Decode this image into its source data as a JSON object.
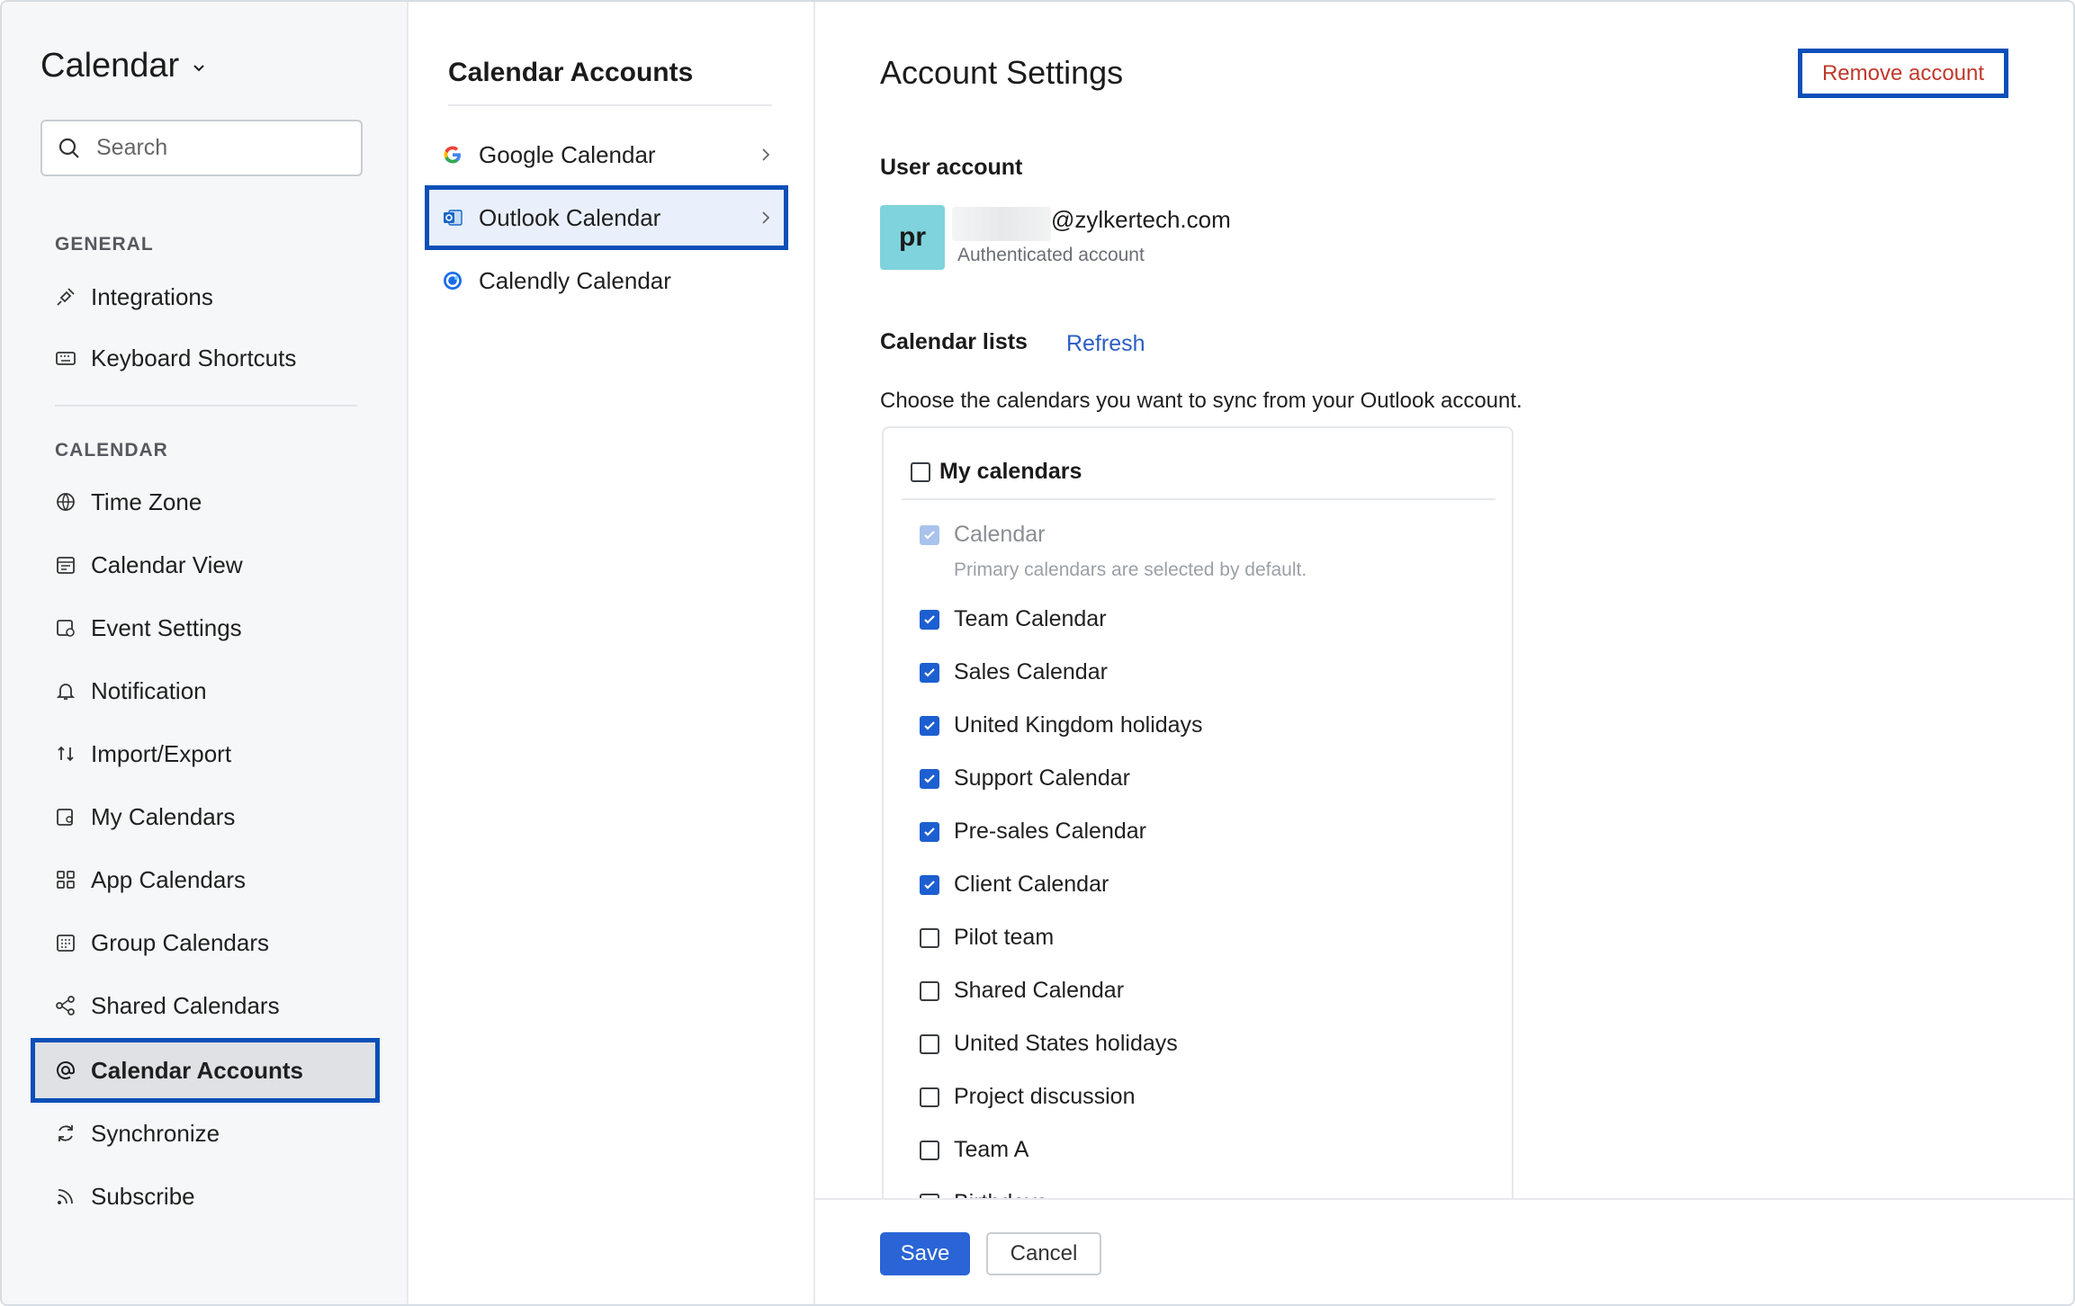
{
  "sidebar": {
    "app_title": "Calendar",
    "search_placeholder": "Search",
    "general_heading": "GENERAL",
    "general_items": [
      {
        "label": "Integrations",
        "icon": "plug-icon"
      },
      {
        "label": "Keyboard Shortcuts",
        "icon": "keyboard-icon"
      }
    ],
    "calendar_heading": "CALENDAR",
    "calendar_items": [
      {
        "label": "Time Zone",
        "icon": "globe-icon"
      },
      {
        "label": "Calendar View",
        "icon": "calendar-view-icon"
      },
      {
        "label": "Event Settings",
        "icon": "event-settings-icon"
      },
      {
        "label": "Notification",
        "icon": "bell-icon"
      },
      {
        "label": "Import/Export",
        "icon": "import-export-icon"
      },
      {
        "label": "My Calendars",
        "icon": "my-calendars-icon"
      },
      {
        "label": "App Calendars",
        "icon": "apps-grid-icon"
      },
      {
        "label": "Group Calendars",
        "icon": "group-calendar-icon"
      },
      {
        "label": "Shared Calendars",
        "icon": "share-icon"
      },
      {
        "label": "Calendar Accounts",
        "icon": "at-sign-icon",
        "active": true
      },
      {
        "label": "Synchronize",
        "icon": "sync-icon"
      },
      {
        "label": "Subscribe",
        "icon": "rss-icon"
      }
    ]
  },
  "accounts": {
    "title": "Calendar Accounts",
    "items": [
      {
        "label": "Google Calendar",
        "icon": "google-icon"
      },
      {
        "label": "Outlook Calendar",
        "icon": "outlook-icon",
        "active": true
      },
      {
        "label": "Calendly Calendar",
        "icon": "calendly-icon"
      }
    ]
  },
  "settings": {
    "title": "Account Settings",
    "remove_label": "Remove account",
    "user_account_label": "User account",
    "avatar_initials": "pr",
    "email_domain": "@zylkertech.com",
    "auth_note": "Authenticated account",
    "lists_label": "Calendar lists",
    "refresh_label": "Refresh",
    "lists_description": "Choose the calendars you want to sync from your Outlook account.",
    "group_label": "My calendars",
    "primary_calendar": "Calendar",
    "primary_note": "Primary calendars are selected by default.",
    "calendars": [
      {
        "label": "Team Calendar",
        "checked": true
      },
      {
        "label": "Sales Calendar",
        "checked": true
      },
      {
        "label": "United Kingdom holidays",
        "checked": true
      },
      {
        "label": "Support Calendar",
        "checked": true
      },
      {
        "label": "Pre-sales Calendar",
        "checked": true
      },
      {
        "label": "Client Calendar",
        "checked": true
      },
      {
        "label": "Pilot team",
        "checked": false
      },
      {
        "label": "Shared Calendar",
        "checked": false
      },
      {
        "label": "United States holidays",
        "checked": false
      },
      {
        "label": "Project discussion",
        "checked": false
      },
      {
        "label": "Team A",
        "checked": false
      },
      {
        "label": "Birthdays",
        "checked": false
      }
    ],
    "save_label": "Save",
    "cancel_label": "Cancel"
  },
  "colors": {
    "accent": "#2a64d6",
    "highlight_border": "#0a4fb8",
    "danger": "#c0392b",
    "avatar_bg": "#7fd3dc"
  }
}
